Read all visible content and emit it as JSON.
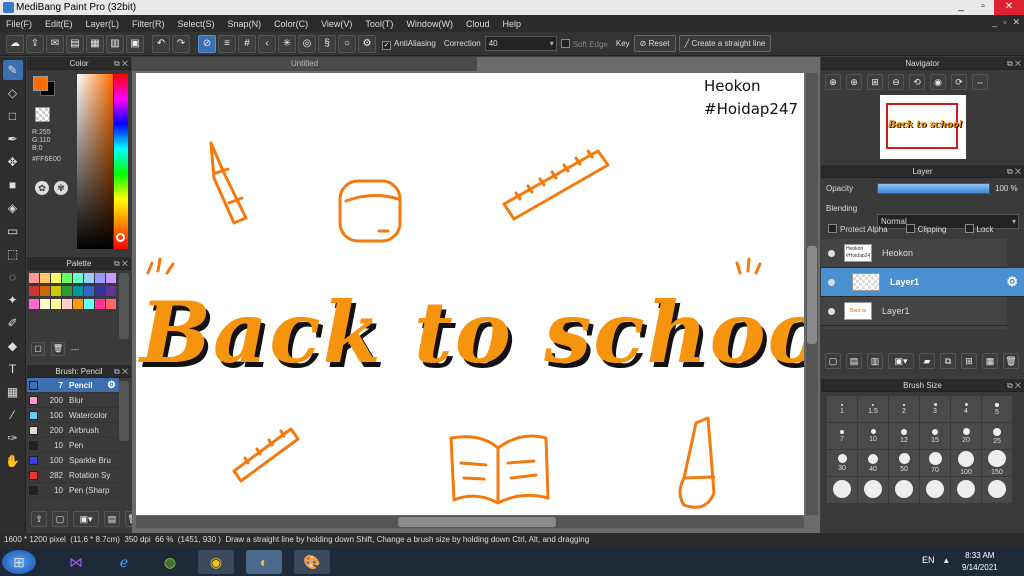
{
  "window": {
    "title": "MediBang Paint Pro (32bit)",
    "controls": [
      "_",
      "▫",
      "✕"
    ]
  },
  "menu": [
    "File(F)",
    "Edit(E)",
    "Layer(L)",
    "Filter(R)",
    "Select(S)",
    "Snap(N)",
    "Color(C)",
    "View(V)",
    "Tool(T)",
    "Window(W)",
    "Cloud",
    "Help"
  ],
  "toolbar": {
    "antialiasing": "AntiAliasing",
    "correction_label": "Correction",
    "correction_value": "40",
    "soft_edge": "Soft Edge",
    "key_label": "Key",
    "reset": "Reset",
    "straight_line": "Create a straight line"
  },
  "color_panel": {
    "title": "Color",
    "r": "R:255",
    "g": "G:110",
    "b": "B:0",
    "hex": "#FF6E00",
    "fg": "#FF6E00",
    "bg": "#000000"
  },
  "palette_panel": {
    "title": "Palette",
    "footer": "---",
    "swatches": [
      "#ff9999",
      "#ffcc66",
      "#ffff66",
      "#66ff66",
      "#66ffcc",
      "#99ccff",
      "#9999ff",
      "#cc99ff",
      "#cc3333",
      "#cc6600",
      "#cccc00",
      "#339933",
      "#009999",
      "#3366cc",
      "#333399",
      "#663399",
      "#ff66cc",
      "#ffffcc",
      "#ffff99",
      "#ffcccc",
      "#ff9900",
      "#66ffff",
      "#ff3399",
      "#ff6666"
    ]
  },
  "brush_panel": {
    "title": "Brush: Pencil",
    "items": [
      {
        "size": "7",
        "name": "Pencil",
        "color": "#3b6fb0"
      },
      {
        "size": "200",
        "name": "Blur",
        "color": "#ff99cc"
      },
      {
        "size": "100",
        "name": "Watercolor",
        "color": "#66ccee"
      },
      {
        "size": "200",
        "name": "Airbrush",
        "color": "#dddddd"
      },
      {
        "size": "10",
        "name": "Pen",
        "color": "#222222"
      },
      {
        "size": "100",
        "name": "Sparkle Bru",
        "color": "#3344ee"
      },
      {
        "size": "282",
        "name": "Rotation Sy",
        "color": "#ee3333"
      },
      {
        "size": "10",
        "name": "Pen (Sharp",
        "color": "#222222"
      }
    ]
  },
  "document": {
    "tab": "Untitled",
    "watermark_line1": "Heokon",
    "watermark_line2": "#Hoidap247",
    "artwork_text": "Back to school"
  },
  "navigator": {
    "title": "Navigator",
    "thumb_text": "Back to school"
  },
  "layer_panel": {
    "title": "Layer",
    "opacity_label": "Opacity",
    "opacity_value": "100 %",
    "opacity_fraction": 1.0,
    "blending_label": "Blending",
    "blending_value": "Normal",
    "protect_alpha": "Protect Alpha",
    "clipping": "Clipping",
    "lock": "Lock",
    "layers": [
      {
        "name": "Heokon",
        "thumb": "Heokon #Hoidap247"
      },
      {
        "name": "Layer1",
        "thumb": ""
      },
      {
        "name": "Layer1",
        "thumb": "Back to school"
      }
    ]
  },
  "brush_size_panel": {
    "title": "Brush Size",
    "sizes": [
      "1",
      "1.5",
      "2",
      "3",
      "4",
      "5",
      "7",
      "10",
      "12",
      "15",
      "20",
      "25",
      "30",
      "40",
      "50",
      "70",
      "100",
      "150",
      "",
      "",
      "",
      "",
      "",
      ""
    ]
  },
  "status": {
    "dims": "1600 * 1200 pixel",
    "cm": "(11.6 * 8.7cm)",
    "dpi": "350 dpi",
    "zoom": "66 %",
    "coords": "(1451, 930 )",
    "hint": "Draw a straight line by holding down Shift, Change a brush size by holding down Ctrl, Alt, and dragging"
  },
  "taskbar": {
    "lang": "EN",
    "time": "8:33 AM",
    "date": "9/14/2021"
  }
}
